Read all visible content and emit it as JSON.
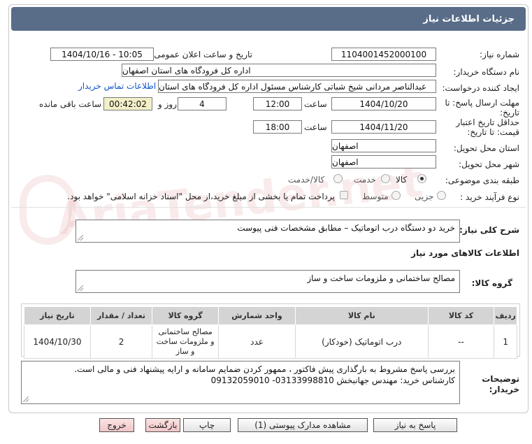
{
  "header": {
    "title": "جزئیات اطلاعات نیاز"
  },
  "fields": {
    "need_number": {
      "label": "شماره نیاز:",
      "value": "1104001452000100"
    },
    "announce_datetime": {
      "label": "تاریخ و ساعت اعلان عمومی:",
      "value": "1404/10/16 - 10:05"
    },
    "buyer_org": {
      "label": "نام دستگاه خریدار:",
      "value": "اداره کل فرودگاه های استان اصفهان"
    },
    "requester": {
      "label": "ایجاد کننده درخواست:",
      "value": "عبدالناصر مردانی شیخ شباتی کارشناس مسئول  اداره کل فرودگاه های استان",
      "contact_link": "اطلاعات تماس خریدار"
    },
    "deadline": {
      "label_line1": "مهلت ارسال پاسخ: تا",
      "label_line2": "تاریخ:",
      "date": "1404/10/20",
      "time_label": "ساعت",
      "time": "12:00",
      "days": "4",
      "days_label": "روز و",
      "remaining": "00:42:02",
      "remaining_label": "ساعت باقی مانده"
    },
    "price_validity": {
      "label_line1": "حداقل تاریخ اعتبار",
      "label_line2": "قیمت: تا تاریخ:",
      "date": "1404/11/20",
      "time_label": "ساعت",
      "time": "18:00"
    },
    "delivery_province": {
      "label": "استان محل تحویل:",
      "value": "اصفهان"
    },
    "delivery_city": {
      "label": "شهر محل تحویل:",
      "value": "اصفهان"
    },
    "category": {
      "label": "طبقه بندی موضوعی:",
      "options": [
        "کالا",
        "خدمت",
        "کالا/خدمت"
      ],
      "selected": "کالا"
    },
    "purchase_type": {
      "label": "نوع فرآیند خرید :",
      "options": [
        "جزیی",
        "متوسط"
      ],
      "payment_note": "پرداخت تمام یا بخشی از مبلغ خرید،از محل \"اسناد خزانه اسلامی\" خواهد بود."
    }
  },
  "summary": {
    "label": "شرح کلی نیاز:",
    "value": "خرید دو دستگاه  درب اتوماتیک – مطابق مشخصات فنی پیوست"
  },
  "goods_section": {
    "title": "اطلاعات کالاهای مورد نیاز"
  },
  "goods_group": {
    "label": "گروه کالا:",
    "value": "مصالح ساختمانی و ملزومات ساخت و ساز"
  },
  "table": {
    "headers": [
      "ردیف",
      "کد کالا",
      "نام کالا",
      "واحد شمارش",
      "گروه کالا",
      "تعداد / مقدار",
      "تاریخ نیاز"
    ],
    "rows": [
      [
        "1",
        "--",
        "درب اتوماتیک (خودکار)",
        "عدد",
        "مصالح ساختمانی و ملزومات ساخت و ساز",
        "2",
        "1404/10/30"
      ]
    ]
  },
  "notes": {
    "label_line1": "توضیحات",
    "label_line2": "خریدار:",
    "line1": "بررسی پاسخ مشروط  به بارگذاری پیش فاکتور ،  ممهور کردن ضمایم سامانه و ارایه پیشنهاد فنی و  مالی است.",
    "line2": "کارشناس خرید: مهندس جهانبخش  03133998810- 09132059010"
  },
  "buttons": {
    "reply": "پاسخ به نیاز",
    "docs": "مشاهده مدارک پیوستی (1)",
    "print": "چاپ",
    "back": "بازگشت",
    "exit": "خروج"
  }
}
